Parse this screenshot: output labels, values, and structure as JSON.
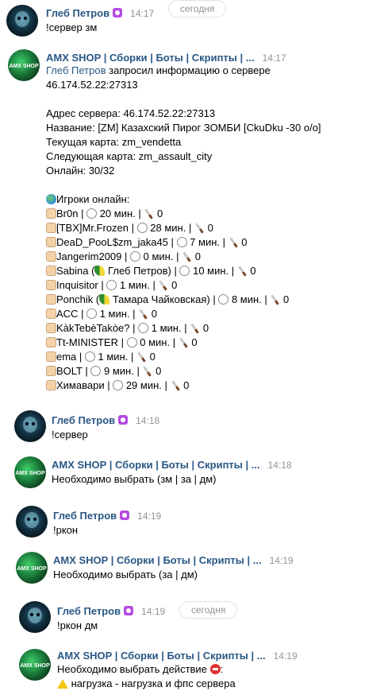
{
  "messages": [
    {
      "author": "Глеб Петров",
      "time": "14:17",
      "date_label": "сегодня",
      "text": "!сервер зм"
    },
    {
      "author": "AMX SHOP | Сборки | Боты | Скрипты | ...",
      "time": "14:17",
      "requester": "Глеб Петров",
      "request_suffix": "запросил информацию о сервере",
      "server_ip": "46.174.52.22:27313",
      "address_line": "Адрес сервера: 46.174.52.22:27313",
      "name_line": "Название: [ZM] Казахский Пирог ЗОМБИ [CkuDku -30 o/o]",
      "map_line": "Текущая карта: zm_vendetta",
      "next_map_line": "Следующая карта: zm_assault_city",
      "online_line": "Онлайн: 30/32",
      "players_header": "Игроки онлайн:",
      "players": [
        {
          "name": "Br0n",
          "minutes": "20 мин.",
          "kills": "0"
        },
        {
          "name": "[TBX]Mr.Frozen",
          "minutes": "28 мин.",
          "kills": "0"
        },
        {
          "name": "DeaD_PooL$zm_jaka45",
          "minutes": "7 мин.",
          "kills": "0"
        },
        {
          "name": "Jangerim2009",
          "minutes": "0 мин.",
          "kills": "0"
        },
        {
          "name": "Sabina (",
          "tag": "Глеб Петров)",
          "minutes": "10 мин.",
          "kills": "0"
        },
        {
          "name": "Inquisitor",
          "minutes": "1 мин.",
          "kills": "0"
        },
        {
          "name": "Ponchik (",
          "tag": "Тамара Чайковская)",
          "minutes": "8 мин.",
          "kills": "0"
        },
        {
          "name": "ACC",
          "minutes": "1 мин.",
          "kills": "0"
        },
        {
          "name": "KàkTebèTakòe?",
          "minutes": "1 мин.",
          "kills": "0"
        },
        {
          "name": "Tt-MINISTER",
          "minutes": "0 мин.",
          "kills": "0"
        },
        {
          "name": "ema",
          "minutes": "1 мин.",
          "kills": "0"
        },
        {
          "name": "BOLT",
          "minutes": "9 мин.",
          "kills": "0"
        },
        {
          "name": "Химавари",
          "minutes": "29 мин.",
          "kills": "0"
        }
      ]
    },
    {
      "author": "Глеб Петров",
      "time": "14:18",
      "text": "!сервер"
    },
    {
      "author": "AMX SHOP | Сборки | Боты | Скрипты | ...",
      "time": "14:18",
      "text": "Необходимо выбрать (зм | за | дм)"
    },
    {
      "author": "Глеб Петров",
      "time": "14:19",
      "text": "!ркон"
    },
    {
      "author": "AMX SHOP | Сборки | Боты | Скрипты | ...",
      "time": "14:19",
      "text": "Необходимо выбрать (за | дм)"
    },
    {
      "author": "Глеб Петров",
      "time": "14:19",
      "date_label": "сегодня",
      "text": "!ркон дм"
    },
    {
      "author": "AMX SHOP | Сборки | Боты | Скрипты | ...",
      "time": "14:19",
      "text": "Необходимо выбрать действие",
      "text2": "нагрузка - нагрузка и фпс сервера"
    }
  ],
  "colors": {
    "link": "#2a5885",
    "time": "#939393",
    "text": "#000000"
  },
  "icons": {
    "globe": "globe-icon",
    "player": "player-icon",
    "timer": "timer-icon",
    "knife": "knife-icon"
  }
}
